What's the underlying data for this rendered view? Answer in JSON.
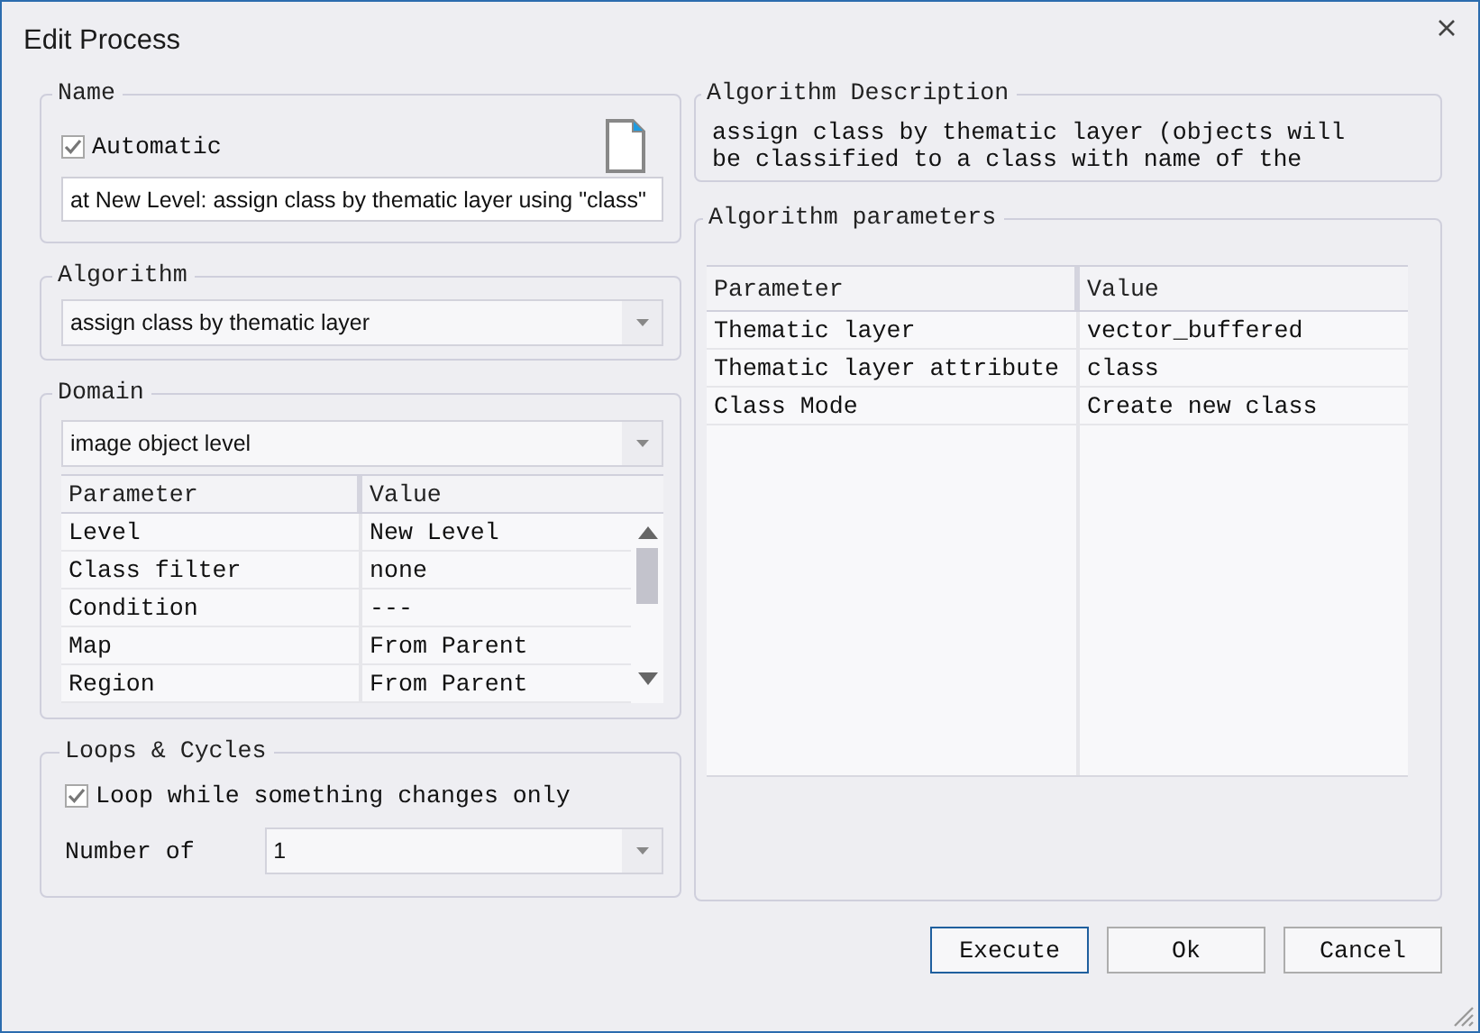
{
  "window": {
    "title": "Edit Process"
  },
  "name": {
    "legend": "Name",
    "automatic": {
      "label": "Automatic",
      "checked": true
    },
    "value": "at New Level: assign class by thematic layer using \"class\""
  },
  "algorithm": {
    "legend": "Algorithm",
    "value": "assign class by thematic layer"
  },
  "domain": {
    "legend": "Domain",
    "value": "image object level",
    "columns": [
      "Parameter",
      "Value"
    ],
    "rows": [
      [
        "Level",
        "New Level"
      ],
      [
        "Class filter",
        "none"
      ],
      [
        "Condition",
        "---"
      ],
      [
        "Map",
        "From Parent"
      ],
      [
        "Region",
        "From Parent"
      ]
    ]
  },
  "loops": {
    "legend": "Loops & Cycles",
    "loop": {
      "label": "Loop while something changes only",
      "checked": true
    },
    "number_label": "Number of",
    "number_value": "1"
  },
  "description": {
    "legend": "Algorithm Description",
    "lines": [
      "assign class by thematic layer (objects will",
      "be classified to a class with name of the"
    ]
  },
  "parameters": {
    "legend": "Algorithm parameters",
    "columns": [
      "Parameter",
      "Value"
    ],
    "rows": [
      [
        "Thematic layer",
        "vector_buffered"
      ],
      [
        "Thematic layer attribute",
        "class"
      ],
      [
        "Class Mode",
        "Create new class"
      ]
    ]
  },
  "buttons": [
    {
      "label": "Execute",
      "default": true
    },
    {
      "label": "Ok",
      "default": false
    },
    {
      "label": "Cancel",
      "default": false
    }
  ]
}
